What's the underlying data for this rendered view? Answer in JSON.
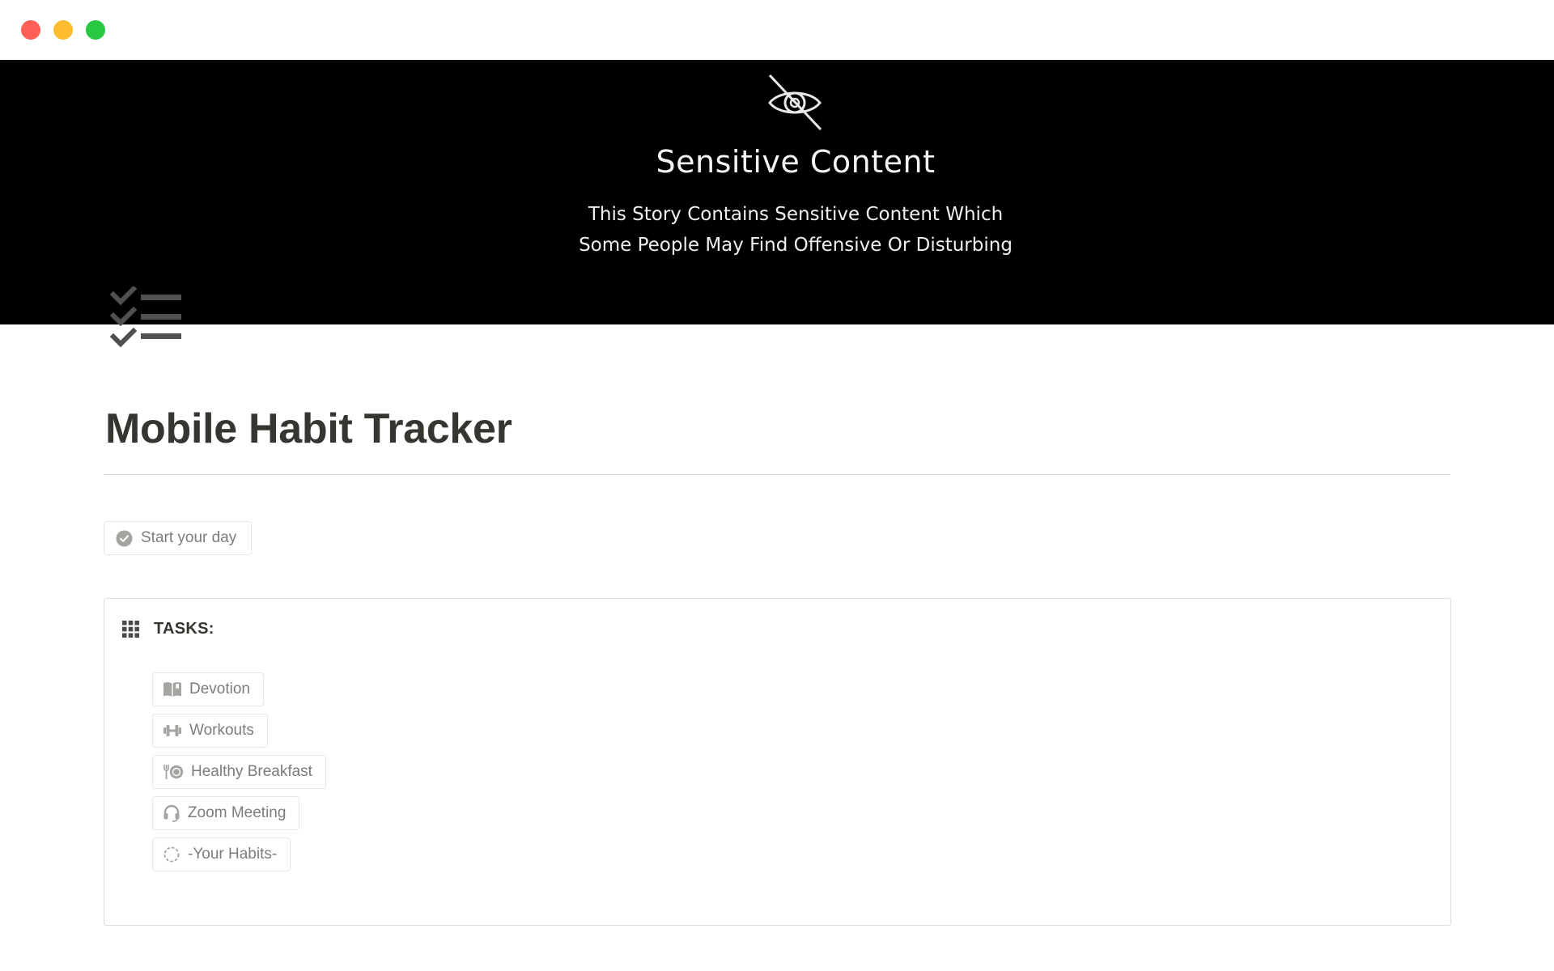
{
  "window": {
    "traffic_colors": {
      "close": "#ff5f57",
      "minimize": "#febc2e",
      "maximize": "#28c840"
    }
  },
  "cover": {
    "icon": "eye-slash-icon",
    "title": "Sensitive Content",
    "text_line1": "This Story Contains Sensitive Content Which",
    "text_line2": "Some People May Find Offensive Or Disturbing"
  },
  "page": {
    "icon": "checklist-icon",
    "title": "Mobile Habit Tracker"
  },
  "start_button": {
    "icon": "check-circle-icon",
    "label": "Start your day"
  },
  "tasks": {
    "icon": "grid-icon",
    "label": "TASKS:",
    "items": [
      {
        "icon": "book-icon",
        "label": "Devotion"
      },
      {
        "icon": "dumbbell-icon",
        "label": "Workouts"
      },
      {
        "icon": "fork-plate-icon",
        "label": "Healthy Breakfast"
      },
      {
        "icon": "headset-icon",
        "label": "Zoom Meeting"
      },
      {
        "icon": "dashed-circle-icon",
        "label": "-Your Habits-"
      }
    ]
  },
  "colors": {
    "text": "#37352f",
    "muted_text": "#7d7c78",
    "icon_gray": "#a5a4a0",
    "border": "#e6e6e4",
    "cover_bg": "#000000"
  }
}
